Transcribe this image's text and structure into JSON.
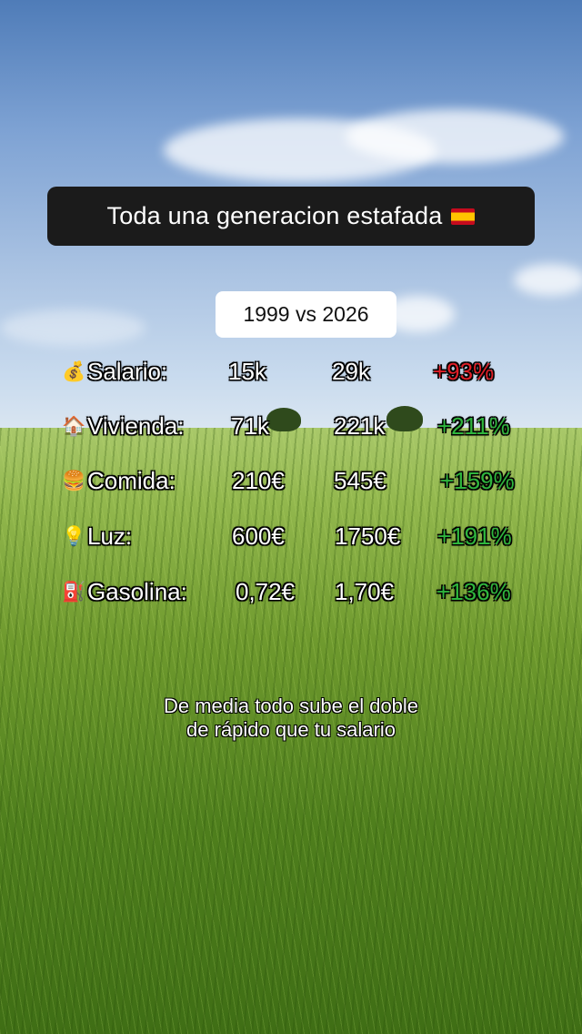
{
  "title": {
    "text": "Toda una generacion estafada",
    "flag_icon": "spain-flag-icon"
  },
  "comparison": {
    "years": "1999 vs  2026"
  },
  "rows": [
    {
      "icon": "money-bag-icon",
      "glyph": "💰",
      "label": "Salario:",
      "old": "15k",
      "new": "29k",
      "change": "+93%",
      "change_color": "#e01f28"
    },
    {
      "icon": "house-icon",
      "glyph": "🏠",
      "label": "Vivienda:",
      "old": "71k",
      "new": "221k",
      "change": "+211%",
      "change_color": "#2fb53d"
    },
    {
      "icon": "burger-icon",
      "glyph": "🍔",
      "label": "Comida:",
      "old": "210€",
      "new": "545€",
      "change": "+159%",
      "change_color": "#2fb53d"
    },
    {
      "icon": "light-bulb-icon",
      "glyph": "💡",
      "label": "Luz:",
      "old": "600€",
      "new": "1750€",
      "change": "+191%",
      "change_color": "#2fb53d"
    },
    {
      "icon": "fuel-pump-icon",
      "glyph": "⛽",
      "label": "Gasolina:",
      "old": "0,72€",
      "new": "1,70€",
      "change": "+136%",
      "change_color": "#2fb53d"
    }
  ],
  "caption": {
    "line1": "De media todo sube el doble",
    "line2": "de rápido que tu salario"
  }
}
